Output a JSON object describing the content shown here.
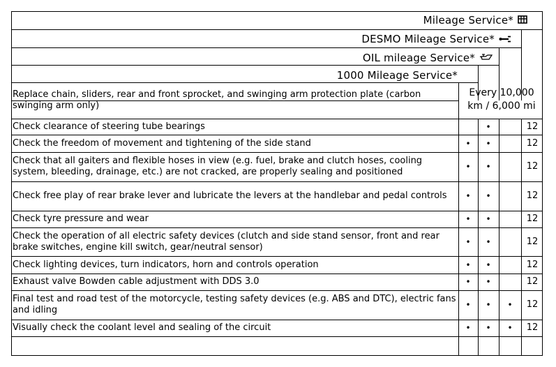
{
  "headers": {
    "mileage": "Mileage Service*",
    "desmo": "DESMO Mileage Service*",
    "oil": "OIL mileage Service*",
    "first": "1000 Mileage Service*"
  },
  "icons": {
    "mileage": "service-grid-icon",
    "desmo": "wrench-icon",
    "oil": "oil-can-icon"
  },
  "first_row": {
    "text": "Replace chain, sliders, rear and front sprocket, and swinging arm protection plate (carbon swinging arm only)",
    "interval": "Every 10,000 km / 6,000 mi"
  },
  "rows": [
    {
      "text": "Check clearance of steering tube bearings",
      "c1000": "",
      "coil": "•",
      "cdesmo": "",
      "mileage": "12"
    },
    {
      "text": "Check the freedom of movement and tightening of the side stand",
      "c1000": "•",
      "coil": "•",
      "cdesmo": "",
      "mileage": "12"
    },
    {
      "text": "Check that all gaiters and flexible hoses in view (e.g. fuel, brake and clutch hoses, cooling system, bleeding, drainage, etc.) are not cracked, are properly sealing and positioned",
      "c1000": "•",
      "coil": "•",
      "cdesmo": "",
      "mileage": "12"
    },
    {
      "text": "Check free play of rear brake lever and lubricate the levers at the handlebar and pedal controls",
      "c1000": "•",
      "coil": "•",
      "cdesmo": "",
      "mileage": "12"
    },
    {
      "text": "Check tyre pressure and wear",
      "c1000": "•",
      "coil": "•",
      "cdesmo": "",
      "mileage": "12"
    },
    {
      "text": "Check the operation of all electric safety devices (clutch and side stand sensor, front and rear brake switches, engine kill switch, gear/neutral sensor)",
      "c1000": "•",
      "coil": "•",
      "cdesmo": "",
      "mileage": "12"
    },
    {
      "text": "Check lighting devices, turn indicators, horn and controls operation",
      "c1000": "•",
      "coil": "•",
      "cdesmo": "",
      "mileage": "12"
    },
    {
      "text": "Exhaust valve Bowden cable adjustment with DDS 3.0",
      "c1000": "•",
      "coil": "•",
      "cdesmo": "",
      "mileage": "12"
    },
    {
      "text": "Final test and road test of the motorcycle, testing safety devices (e.g. ABS and DTC), electric fans and idling",
      "c1000": "•",
      "coil": "•",
      "cdesmo": "•",
      "mileage": "12"
    },
    {
      "text": "Visually check the coolant level and sealing of the circuit",
      "c1000": "•",
      "coil": "•",
      "cdesmo": "•",
      "mileage": "12"
    }
  ]
}
